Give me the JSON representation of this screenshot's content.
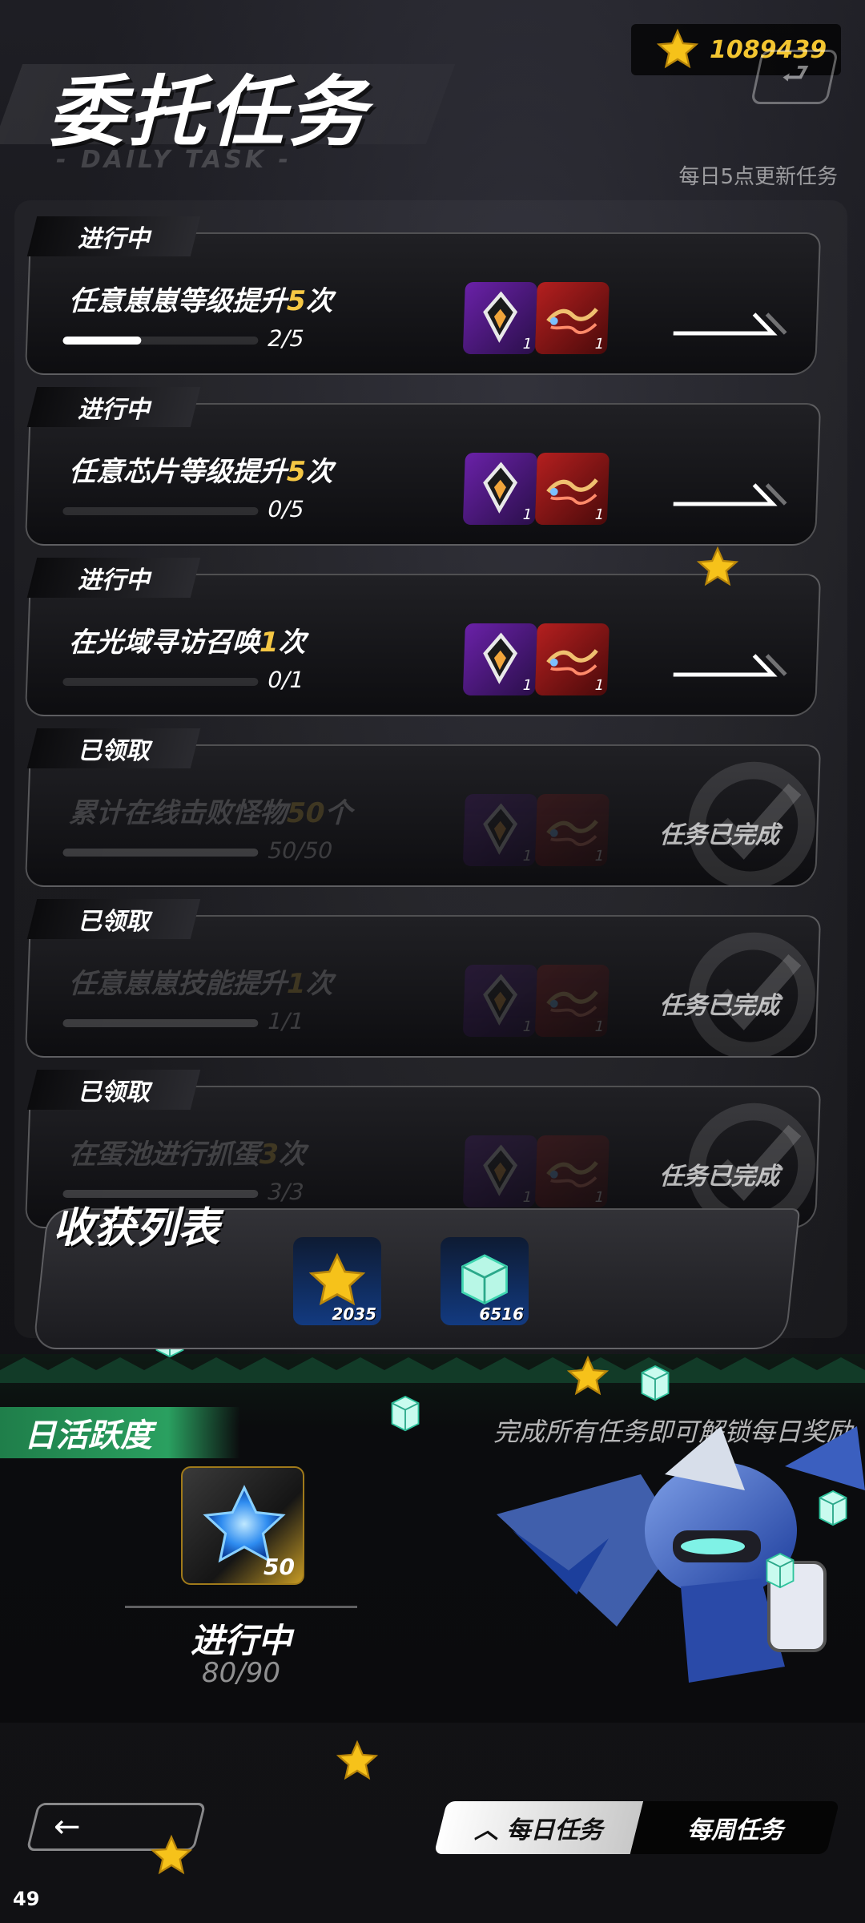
{
  "header": {
    "title": "委托任务",
    "subtitle": "- DAILY TASK -",
    "currency_value": "1089439",
    "refresh_note": "每日5点更新任务"
  },
  "tasks": [
    {
      "status": "进行中",
      "name_pre": "任意崽崽等级提升",
      "name_num": "5",
      "name_post": "次",
      "progress_text": "2/5",
      "progress_fraction": 0.4,
      "reward_counts": [
        "1",
        "1"
      ]
    },
    {
      "status": "进行中",
      "name_pre": "任意芯片等级提升",
      "name_num": "5",
      "name_post": "次",
      "progress_text": "0/5",
      "progress_fraction": 0,
      "reward_counts": [
        "1",
        "1"
      ]
    },
    {
      "status": "进行中",
      "name_pre": "在光域寻访召唤",
      "name_num": "1",
      "name_post": "次",
      "progress_text": "0/1",
      "progress_fraction": 0,
      "reward_counts": [
        "1",
        "1"
      ]
    },
    {
      "status": "已领取",
      "name_pre": "累计在线击败怪物",
      "name_num": "50",
      "name_post": "个",
      "progress_text": "50/50",
      "progress_fraction": 1,
      "reward_counts": [
        "1",
        "1"
      ],
      "done_text": "任务已完成"
    },
    {
      "status": "已领取",
      "name_pre": "任意崽崽技能提升",
      "name_num": "1",
      "name_post": "次",
      "progress_text": "1/1",
      "progress_fraction": 1,
      "reward_counts": [
        "1",
        "1"
      ],
      "done_text": "任务已完成"
    },
    {
      "status": "已领取",
      "name_pre": "在蛋池进行抓蛋",
      "name_num": "3",
      "name_post": "次",
      "progress_text": "3/3",
      "progress_fraction": 1,
      "reward_counts": [
        "1",
        "1"
      ],
      "done_text": "任务已完成"
    }
  ],
  "harvest": {
    "title": "收获列表",
    "items": [
      {
        "icon": "gold-star-icon",
        "count": "2035"
      },
      {
        "icon": "crystal-cube-icon",
        "count": "6516"
      }
    ]
  },
  "activity": {
    "label": "日活跃度",
    "hint": "完成所有任务即可解锁每日奖励",
    "reward_count": "50",
    "status": "进行中",
    "progress": "80/90"
  },
  "tabs": {
    "daily": "每日任务",
    "weekly": "每周任务"
  },
  "page_number": "49",
  "colors": {
    "accent_gold": "#f5c744",
    "activity_green": "#2aa060",
    "background": "#15151a"
  }
}
